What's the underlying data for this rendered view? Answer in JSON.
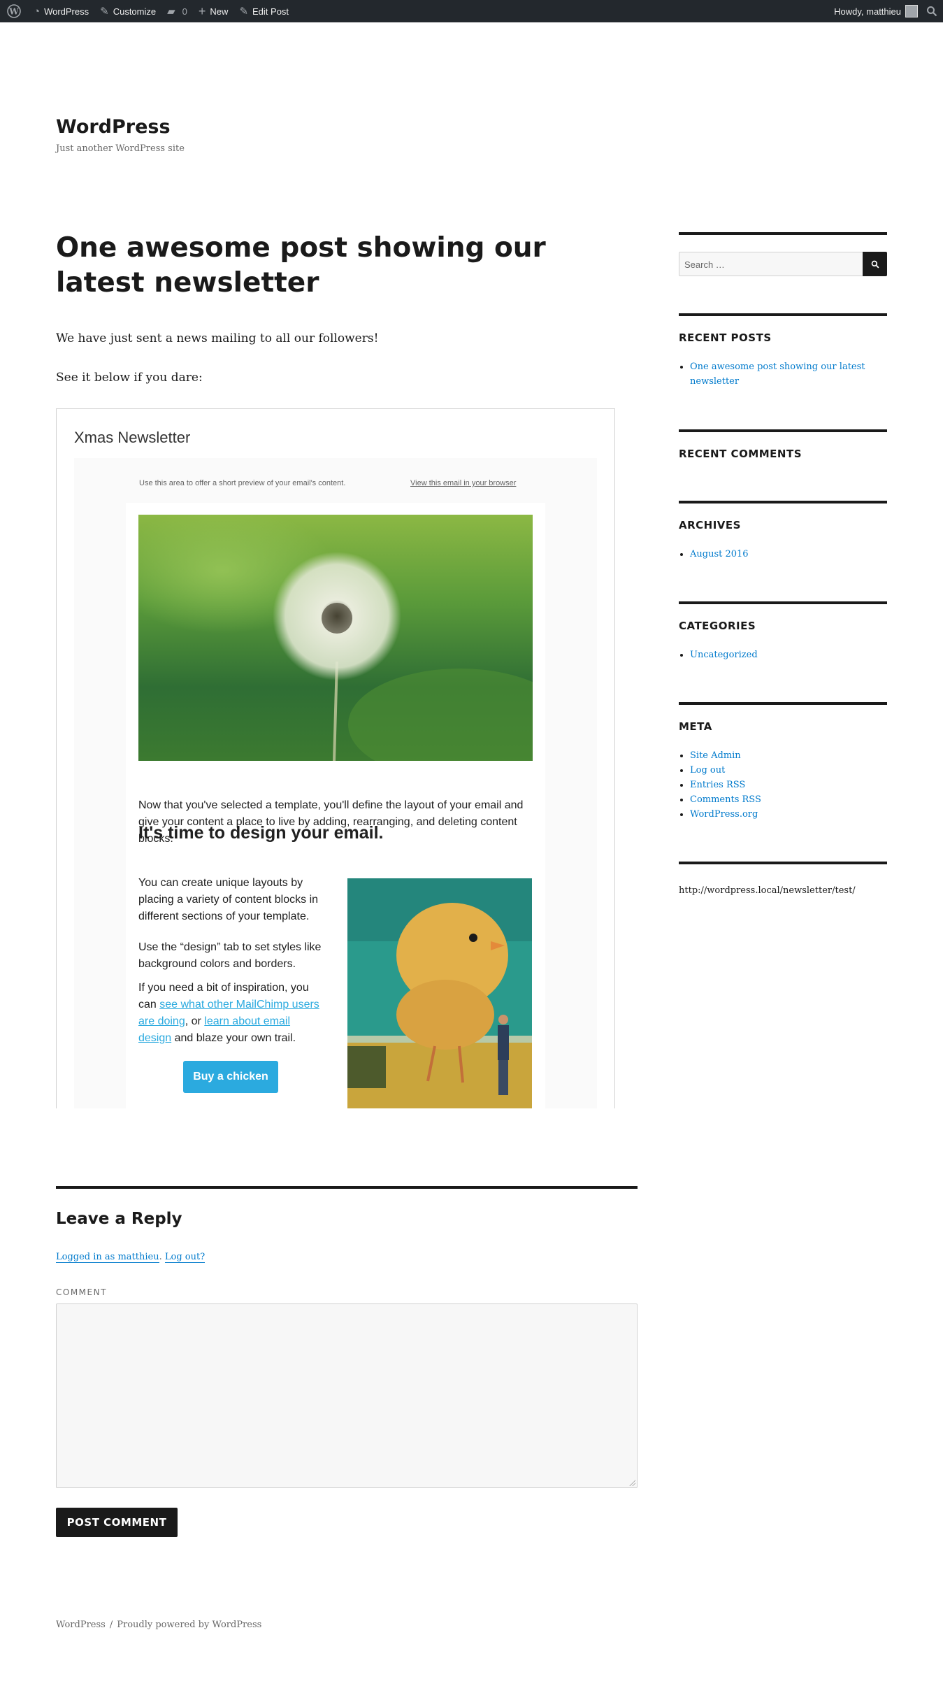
{
  "adminbar": {
    "wp_label": "WordPress",
    "customize_label": "Customize",
    "comments_count": "0",
    "new_label": "New",
    "edit_label": "Edit Post",
    "howdy": "Howdy, matthieu"
  },
  "site": {
    "title": "WordPress",
    "description": "Just another WordPress site"
  },
  "post": {
    "title": "One awesome post showing our latest newsletter",
    "paragraphs": [
      "We have just sent a news mailing to all our followers!",
      "See it below if you dare:"
    ]
  },
  "newsletter": {
    "title": "Xmas Newsletter",
    "preheader": "Use this area to offer a short preview of your email's content.",
    "view_link": "View this email in your browser",
    "heading": "It's time to design your email.",
    "intro": "Now that you've selected a template, you'll define the layout of your email and give your content a place to live by adding, rearranging, and deleting content blocks.",
    "col_p1": "You can create unique layouts by placing a variety of content blocks in different sections of your template.",
    "col_p2": "Use the “design” tab to set styles like background colors and borders.",
    "col_p3_a": "If you need a bit of inspiration, you can ",
    "col_link1": "see what other MailChimp users are doing",
    "col_p3_b": ", or ",
    "col_link2": "learn about email design",
    "col_p3_c": " and blaze your own trail.",
    "button": "Buy a chicken",
    "accent_color": "#2baadf"
  },
  "sidebar": {
    "search_placeholder": "Search …",
    "recent_posts_title": "RECENT POSTS",
    "recent_posts": [
      "One awesome post showing our latest newsletter"
    ],
    "recent_comments_title": "RECENT COMMENTS",
    "archives_title": "ARCHIVES",
    "archives": [
      "August 2016"
    ],
    "categories_title": "CATEGORIES",
    "categories": [
      "Uncategorized"
    ],
    "meta_title": "META",
    "meta": [
      "Site Admin",
      "Log out",
      "Entries RSS",
      "Comments RSS",
      "WordPress.org"
    ],
    "text_widget": "http://wordpress.local/newsletter/test/"
  },
  "comments": {
    "title": "Leave a Reply",
    "logged_in": "Logged in as matthieu",
    "separator": ". ",
    "logout": "Log out?",
    "label": "COMMENT",
    "submit": "POST COMMENT"
  },
  "footer": {
    "site": "WordPress",
    "separator": "/",
    "powered": "Proudly powered by WordPress"
  },
  "colors": {
    "link": "#007acc",
    "adminbar_bg": "#23282d",
    "text": "#1a1a1a"
  }
}
